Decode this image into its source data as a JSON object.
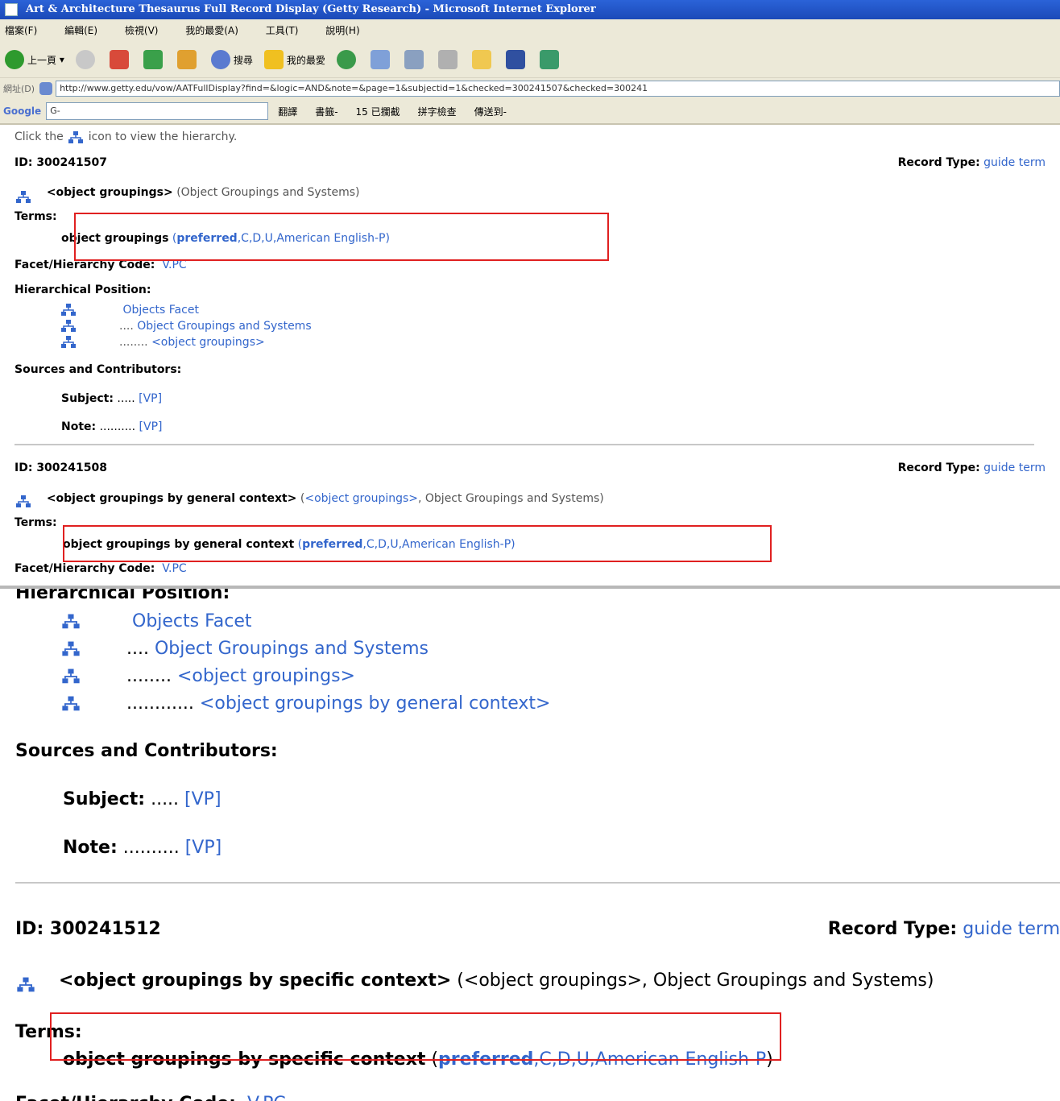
{
  "window": {
    "title": "Art & Architecture Thesaurus Full Record Display (Getty Research) - Microsoft Internet Explorer"
  },
  "menu": [
    "檔案(F)",
    "編輯(E)",
    "檢視(V)",
    "我的最愛(A)",
    "工具(T)",
    "說明(H)"
  ],
  "toolbar": {
    "back": "上一頁",
    "search": "搜尋",
    "favorites": "我的最愛"
  },
  "address": {
    "label": "網址(D)",
    "url": "http://www.getty.edu/vow/AATFullDisplay?find=&logic=AND&note=&page=1&subjectid=1&checked=300241507&checked=300241"
  },
  "googlebar": {
    "logo": "Google",
    "search_placeholder": "G-",
    "items": [
      "翻譯",
      "書籤-",
      "15 已攔截",
      "拼字檢查",
      "傳送到-"
    ]
  },
  "hint": {
    "prefix": "Click the",
    "suffix": "icon to view the hierarchy."
  },
  "labels": {
    "id": "ID:",
    "record_type": "Record Type:",
    "terms": "Terms:",
    "facet_code": "Facet/Hierarchy Code:",
    "hier_pos": "Hierarchical Position:",
    "sources": "Sources and Contributors:",
    "subject": "Subject:",
    "note": "Note:"
  },
  "records": [
    {
      "id": "300241507",
      "record_type": "guide term",
      "heading": "<object groupings>",
      "context": "(Object Groupings and Systems)",
      "term": "object groupings",
      "term_open": "(",
      "preferred": "preferred",
      "flags": ",C,D,U,",
      "lang": "American English-P",
      "term_close": ")",
      "facet_code": "V.PC",
      "hierarchy": [
        {
          "dots": "",
          "label": "Objects Facet"
        },
        {
          "dots": "....",
          "label": "Object Groupings and Systems"
        },
        {
          "dots": "........",
          "label": "<object groupings>"
        }
      ],
      "subject_dots": ".....",
      "subject_src": "[VP]",
      "note_dots": "..........",
      "note_src": "[VP]"
    },
    {
      "id": "300241508",
      "record_type": "guide term",
      "heading": "<object groupings by general context>",
      "context_open": "(",
      "context_link": "<object groupings>",
      "context_rest": ", Object Groupings and Systems)",
      "term": "object groupings by general context",
      "term_open": "(",
      "preferred": "preferred",
      "flags": ",C,D,U,",
      "lang": "American English-P",
      "term_close": ")",
      "facet_code": "V.PC",
      "hierarchy": [
        {
          "dots": "",
          "label": "Objects Facet"
        },
        {
          "dots": "....",
          "label": "Object Groupings and Systems"
        },
        {
          "dots": "........",
          "label": "<object groupings>"
        },
        {
          "dots": "............",
          "label": "<object groupings by general context>"
        }
      ],
      "subject_dots": ".....",
      "subject_src": "[VP]",
      "note_dots": "..........",
      "note_src": "[VP]"
    },
    {
      "id": "300241512",
      "record_type": "guide term",
      "heading": "<object groupings by specific context>",
      "context": "(<object groupings>, Object Groupings and Systems)",
      "term": "object groupings by specific context",
      "term_open": "(",
      "preferred": "preferred",
      "flags": ",C,D,U,",
      "lang": "American English-P",
      "term_close": ")",
      "facet_code": "V.PC"
    }
  ]
}
